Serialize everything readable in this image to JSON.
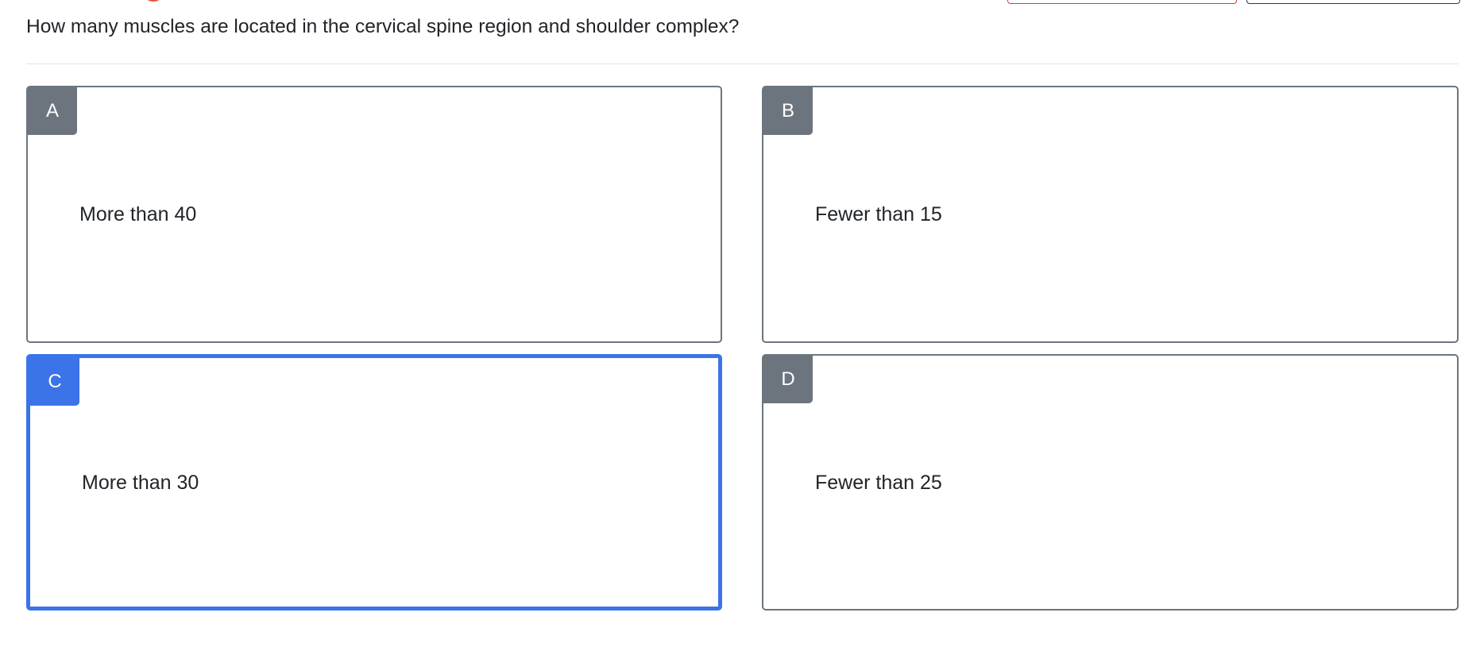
{
  "question": {
    "text": "How many muscles are located in the cervical spine region and shoulder complex?"
  },
  "options": [
    {
      "letter": "A",
      "text": "More than 40",
      "selected": false
    },
    {
      "letter": "B",
      "text": "Fewer than 15",
      "selected": false
    },
    {
      "letter": "C",
      "text": "More than 30",
      "selected": true
    },
    {
      "letter": "D",
      "text": "Fewer than 25",
      "selected": false
    }
  ],
  "colors": {
    "selected_accent": "#3b73e8",
    "badge_default": "#6c757d",
    "danger_outline": "#dc3545",
    "primary_outline": "#1f3a6b"
  }
}
